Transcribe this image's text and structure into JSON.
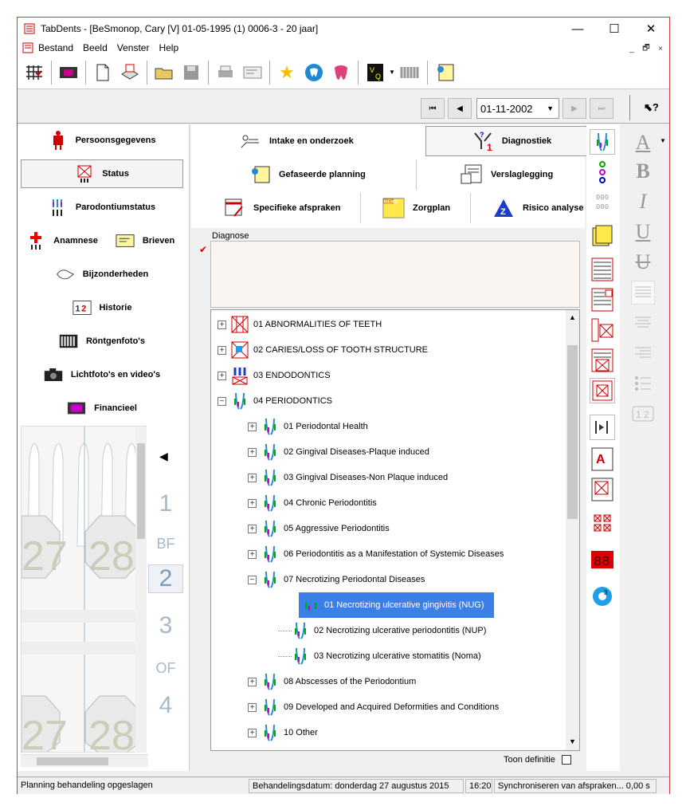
{
  "window": {
    "title": "TabDents - [BeSmonop, Cary [V] 01-05-1995 (1) 0006-3 - 20 jaar]",
    "minimize": "—",
    "maximize": "☐",
    "close": "✕"
  },
  "menu": [
    "Bestand",
    "Beeld",
    "Venster",
    "Help"
  ],
  "mdi_controls": [
    "_",
    "🗗",
    "×"
  ],
  "toolbar_icons": [
    "chart-icon",
    "film-icon",
    "new-document-icon",
    "scanner-icon",
    "open-folder-icon",
    "save-icon",
    "print-icon",
    "form-icon",
    "star-icon",
    "tooth-blue-icon",
    "tooth-pink-icon",
    "vq-icon",
    "dropdown-arrow-icon",
    "teeth-row-icon",
    "planning-icon"
  ],
  "navigation": {
    "date": "01-11-2002",
    "first": "⏮",
    "prev": "◀",
    "next": "▶",
    "last": "⏭",
    "help": "⬉?"
  },
  "left_nav": {
    "personal": "Persoonsgegevens",
    "status": "Status",
    "perio_status": "Parodontiumstatus",
    "anamnese": "Anamnese",
    "brieven": "Brieven",
    "bijzonderheden": "Bijzonderheden",
    "historie": "Historie",
    "rontgen": "Röntgenfoto's",
    "lichtfoto": "Lichtfoto's en video's",
    "financieel": "Financieel"
  },
  "page_numbers": [
    "1",
    "BF",
    "2",
    "3",
    "OF",
    "4"
  ],
  "tabs": {
    "intake": "Intake en onderzoek",
    "diagnostiek": "Diagnostiek",
    "gefaseerde": "Gefaseerde planning",
    "verslag": "Verslaglegging",
    "specifieke": "Specifieke afspraken",
    "zorgplan": "Zorgplan",
    "risico": "Risico analyse"
  },
  "diagnose_label": "Diagnose",
  "tree": [
    {
      "level": 0,
      "expander": "+",
      "label": "01 ABNORMALITIES OF TEETH",
      "icon": "abnormality-icon"
    },
    {
      "level": 0,
      "expander": "+",
      "label": "02 CARIES/LOSS OF TOOTH STRUCTURE",
      "icon": "caries-icon"
    },
    {
      "level": 0,
      "expander": "+",
      "label": "03 ENDODONTICS",
      "icon": "endo-icon"
    },
    {
      "level": 0,
      "expander": "−",
      "label": "04 PERIODONTICS",
      "icon": "perio-icon"
    },
    {
      "level": 1,
      "expander": "+",
      "label": "01 Periodontal Health",
      "icon": "perio-icon"
    },
    {
      "level": 1,
      "expander": "+",
      "label": "02 Gingival Diseases-Plaque induced",
      "icon": "perio-icon"
    },
    {
      "level": 1,
      "expander": "+",
      "label": "03 Gingival Diseases-Non Plaque induced",
      "icon": "perio-icon"
    },
    {
      "level": 1,
      "expander": "+",
      "label": "04 Chronic Periodontitis",
      "icon": "perio-icon"
    },
    {
      "level": 1,
      "expander": "+",
      "label": "05 Aggressive Periodontitis",
      "icon": "perio-icon"
    },
    {
      "level": 1,
      "expander": "+",
      "label": "06 Periodontitis as a Manifestation of Systemic Diseases",
      "icon": "perio-icon"
    },
    {
      "level": 1,
      "expander": "−",
      "label": "07 Necrotizing Periodontal Diseases",
      "icon": "perio-icon"
    },
    {
      "level": 2,
      "expander": "",
      "label": "01 Necrotizing ulcerative gingivitis (NUG)",
      "icon": "perio-icon",
      "selected": true
    },
    {
      "level": 2,
      "expander": "",
      "label": "02 Necrotizing ulcerative periodontitis (NUP)",
      "icon": "perio-icon"
    },
    {
      "level": 2,
      "expander": "",
      "label": "03 Necrotizing ulcerative stomatitis (Noma)",
      "icon": "perio-icon"
    },
    {
      "level": 1,
      "expander": "+",
      "label": "08 Abscesses of the Periodontium",
      "icon": "perio-icon"
    },
    {
      "level": 1,
      "expander": "+",
      "label": "09 Developed and Acquired Deformities and Conditions",
      "icon": "perio-icon"
    },
    {
      "level": 1,
      "expander": "+",
      "label": "10 Other",
      "icon": "perio-icon"
    }
  ],
  "toon_definitie": "Toon definitie",
  "format_buttons": [
    "A",
    "B",
    "I",
    "U",
    "U"
  ],
  "statusbar": {
    "left": "Planning behandeling opgeslagen",
    "date": "Behandelingsdatum: donderdag 27 augustus 2015",
    "time": "16:20",
    "sync": "Synchroniseren van afspraken... 0,00 s"
  },
  "colors": {
    "selection": "#3b80e8",
    "accent_red": "#d03a3a"
  }
}
